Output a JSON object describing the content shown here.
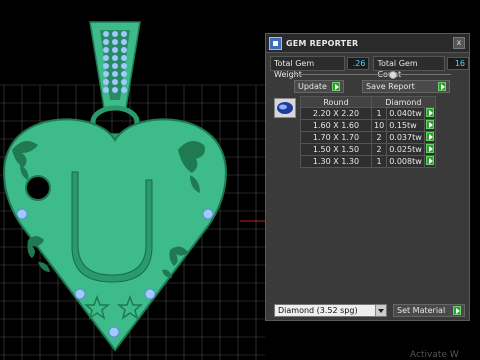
{
  "panel": {
    "title": "GEM REPORTER",
    "close_label": "x",
    "total_weight_label": "Total Gem Weight",
    "total_weight_value": ".26",
    "total_count_label": "Total Gem Count",
    "total_count_value": "16",
    "update_label": "Update",
    "save_report_label": "Save Report",
    "table": {
      "headers": [
        "Round",
        "Diamond"
      ],
      "rows": [
        {
          "size": "2.20 X 2.20",
          "count": "1",
          "weight": "0.040tw"
        },
        {
          "size": "1.60 X 1.60",
          "count": "10",
          "weight": "0.15tw"
        },
        {
          "size": "1.70 X 1.70",
          "count": "2",
          "weight": "0.037tw"
        },
        {
          "size": "1.50 X 1.50",
          "count": "2",
          "weight": "0.025tw"
        },
        {
          "size": "1.30 X 1.30",
          "count": "1",
          "weight": "0.008tw"
        }
      ]
    },
    "material_select": "Diamond     (3.52 spg)",
    "set_material_label": "Set Material"
  },
  "viewport": {
    "letter": "U",
    "watermark": "Activate W"
  },
  "colors": {
    "heart": "#3dbb8a",
    "heart_dark": "#1f7a52",
    "grid": "#5a5a5a",
    "accent_value": "#5ad0ff",
    "gem": "#9fc9ff"
  }
}
